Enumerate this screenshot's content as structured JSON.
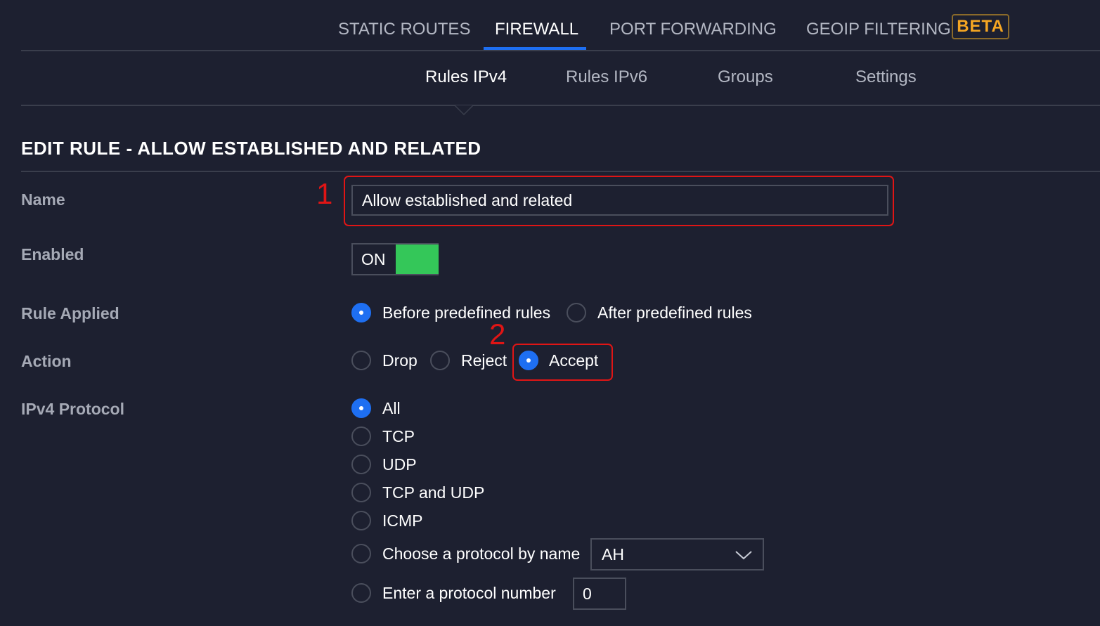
{
  "top_tabs": {
    "static_routes": "STATIC ROUTES",
    "firewall": "FIREWALL",
    "port_forwarding": "PORT FORWARDING",
    "geoip_filtering": "GEOIP FILTERING",
    "beta_badge": "BETA",
    "active": "FIREWALL"
  },
  "sub_tabs": {
    "rules_ipv4": "Rules IPv4",
    "rules_ipv6": "Rules IPv6",
    "groups": "Groups",
    "settings": "Settings",
    "active": "Rules IPv4"
  },
  "section_title": "EDIT RULE - ALLOW ESTABLISHED AND RELATED",
  "form": {
    "name_label": "Name",
    "name_value": "Allow established and related",
    "enabled_label": "Enabled",
    "enabled_toggle_text": "ON",
    "enabled": true,
    "rule_applied_label": "Rule Applied",
    "rule_applied_options": {
      "before": "Before predefined rules",
      "after": "After predefined rules",
      "selected": "before"
    },
    "action_label": "Action",
    "action_options": {
      "drop": "Drop",
      "reject": "Reject",
      "accept": "Accept",
      "selected": "accept"
    },
    "protocol_label": "IPv4 Protocol",
    "protocol_options": {
      "all": "All",
      "tcp": "TCP",
      "udp": "UDP",
      "tcp_udp": "TCP and UDP",
      "icmp": "ICMP",
      "by_name": "Choose a protocol by name",
      "by_number": "Enter a protocol number",
      "selected": "all"
    },
    "protocol_name_value": "AH",
    "protocol_number_value": "0"
  },
  "annotations": {
    "one": "1",
    "two": "2"
  },
  "colors": {
    "background": "#1d2030",
    "accent_blue": "#1e6ff2",
    "toggle_green": "#34c759",
    "beta_orange": "#f5a623",
    "annotation_red": "#e01515"
  }
}
